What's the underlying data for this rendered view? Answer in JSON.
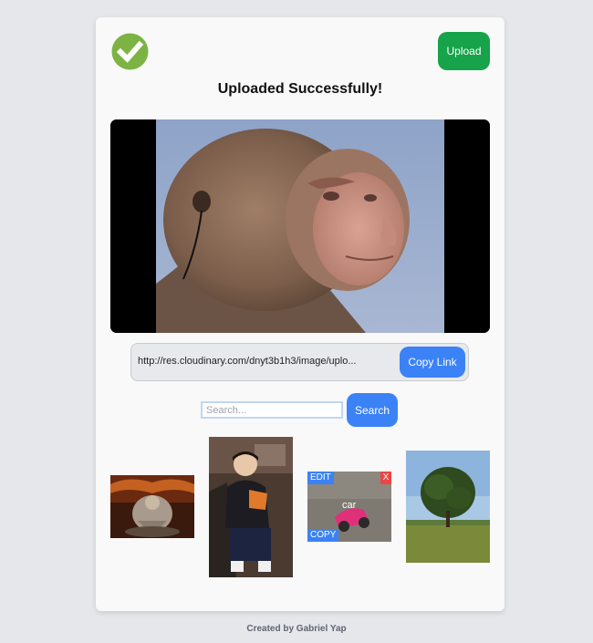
{
  "header": {
    "status_icon": "check-circle-icon",
    "upload_label": "Upload",
    "title": "Uploaded Successfully!"
  },
  "link": {
    "url": "http://res.cloudinary.com/dnyt3b1h3/image/uplo...",
    "copy_label": "Copy Link"
  },
  "search": {
    "placeholder": "Search...",
    "button_label": "Search"
  },
  "gallery": {
    "items": [
      {
        "name": "gallery-image-statue"
      },
      {
        "name": "gallery-image-person"
      },
      {
        "name": "gallery-image-car",
        "edit_label": "EDIT",
        "delete_label": "X",
        "tag": "car",
        "copy_label": "COPY"
      },
      {
        "name": "gallery-image-tree"
      }
    ]
  },
  "footer": {
    "credit": "Created by Gabriel Yap"
  },
  "colors": {
    "success_green": "#16a34a",
    "check_green": "#7cb342",
    "primary_blue": "#3b82f6",
    "danger_red": "#ef4444"
  }
}
